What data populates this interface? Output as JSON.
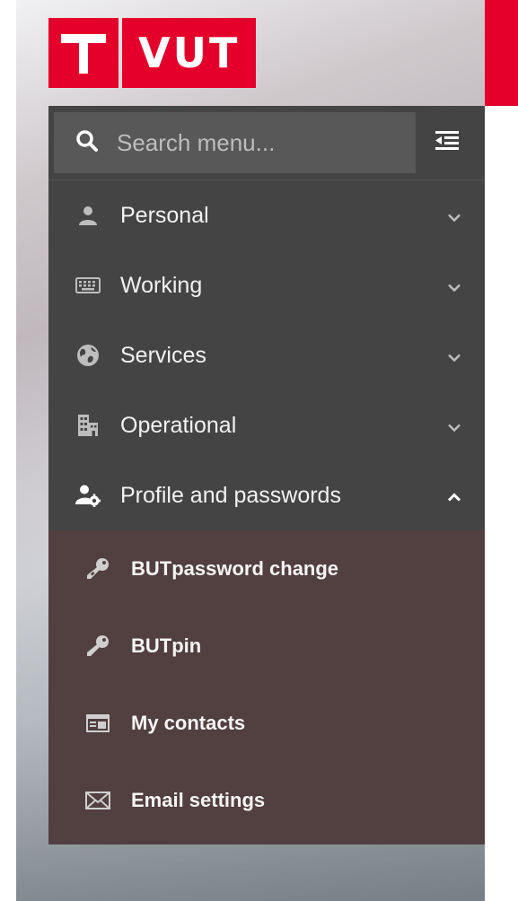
{
  "logo": {
    "text": "VUT"
  },
  "search": {
    "placeholder": "Search menu..."
  },
  "menu": {
    "items": [
      {
        "label": "Personal",
        "icon": "user-icon",
        "expanded": false
      },
      {
        "label": "Working",
        "icon": "keyboard-icon",
        "expanded": false
      },
      {
        "label": "Services",
        "icon": "globe-icon",
        "expanded": false
      },
      {
        "label": "Operational",
        "icon": "building-icon",
        "expanded": false
      },
      {
        "label": "Profile and passwords",
        "icon": "user-cog-icon",
        "expanded": true
      }
    ],
    "subitems": [
      {
        "label": "BUTpassword change",
        "icon": "key-icon"
      },
      {
        "label": "BUTpin",
        "icon": "key-icon"
      },
      {
        "label": "My contacts",
        "icon": "contact-card-icon"
      },
      {
        "label": "Email settings",
        "icon": "envelope-icon"
      }
    ]
  },
  "colors": {
    "brand_red": "#e4002b",
    "menu_bg": "#444444",
    "submenu_bg": "#523f40"
  }
}
